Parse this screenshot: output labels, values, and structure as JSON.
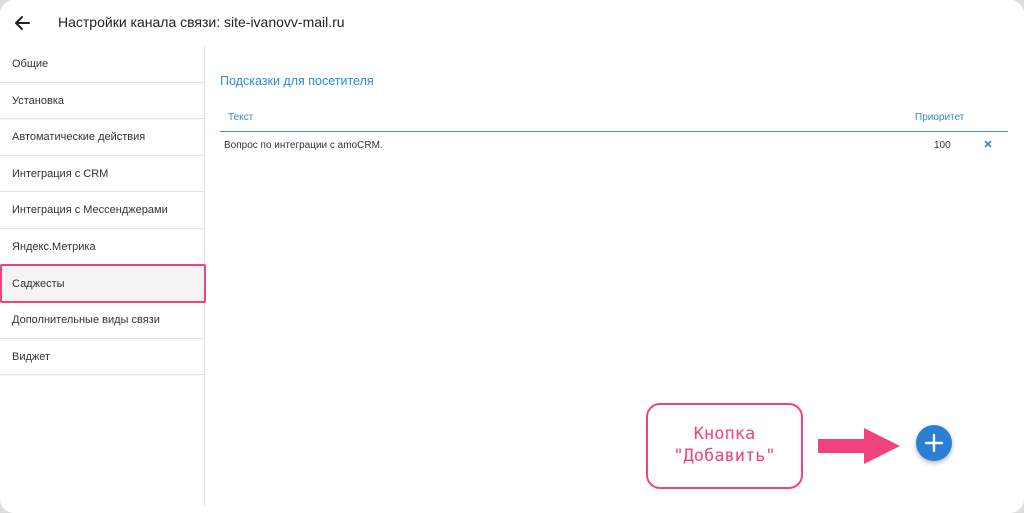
{
  "header": {
    "title": "Настройки канала связи: site-ivanovv-mail.ru",
    "back_icon": "arrow-left-icon"
  },
  "sidebar": {
    "items": [
      {
        "label": "Общие"
      },
      {
        "label": "Установка"
      },
      {
        "label": "Автоматические действия"
      },
      {
        "label": "Интеграция с CRM"
      },
      {
        "label": "Интеграция с Мессенджерами"
      },
      {
        "label": "Яндекс.Метрика"
      },
      {
        "label": "Саджесты",
        "active": true
      },
      {
        "label": "Дополнительные виды связи"
      },
      {
        "label": "Виджет"
      }
    ]
  },
  "main": {
    "section_title": "Подсказки для посетителя",
    "table": {
      "columns": [
        "Текст",
        "Приоритет"
      ],
      "rows": [
        {
          "text": "Вопрос по интеграции с amoCRM.",
          "priority": "100",
          "delete_icon": "close-icon"
        }
      ]
    }
  },
  "annotation": {
    "line1": "Кнопка",
    "line2": "\"Добавить\"",
    "accent": "#f0437e"
  },
  "fab": {
    "icon": "plus-icon",
    "color": "#2a7fd4"
  }
}
